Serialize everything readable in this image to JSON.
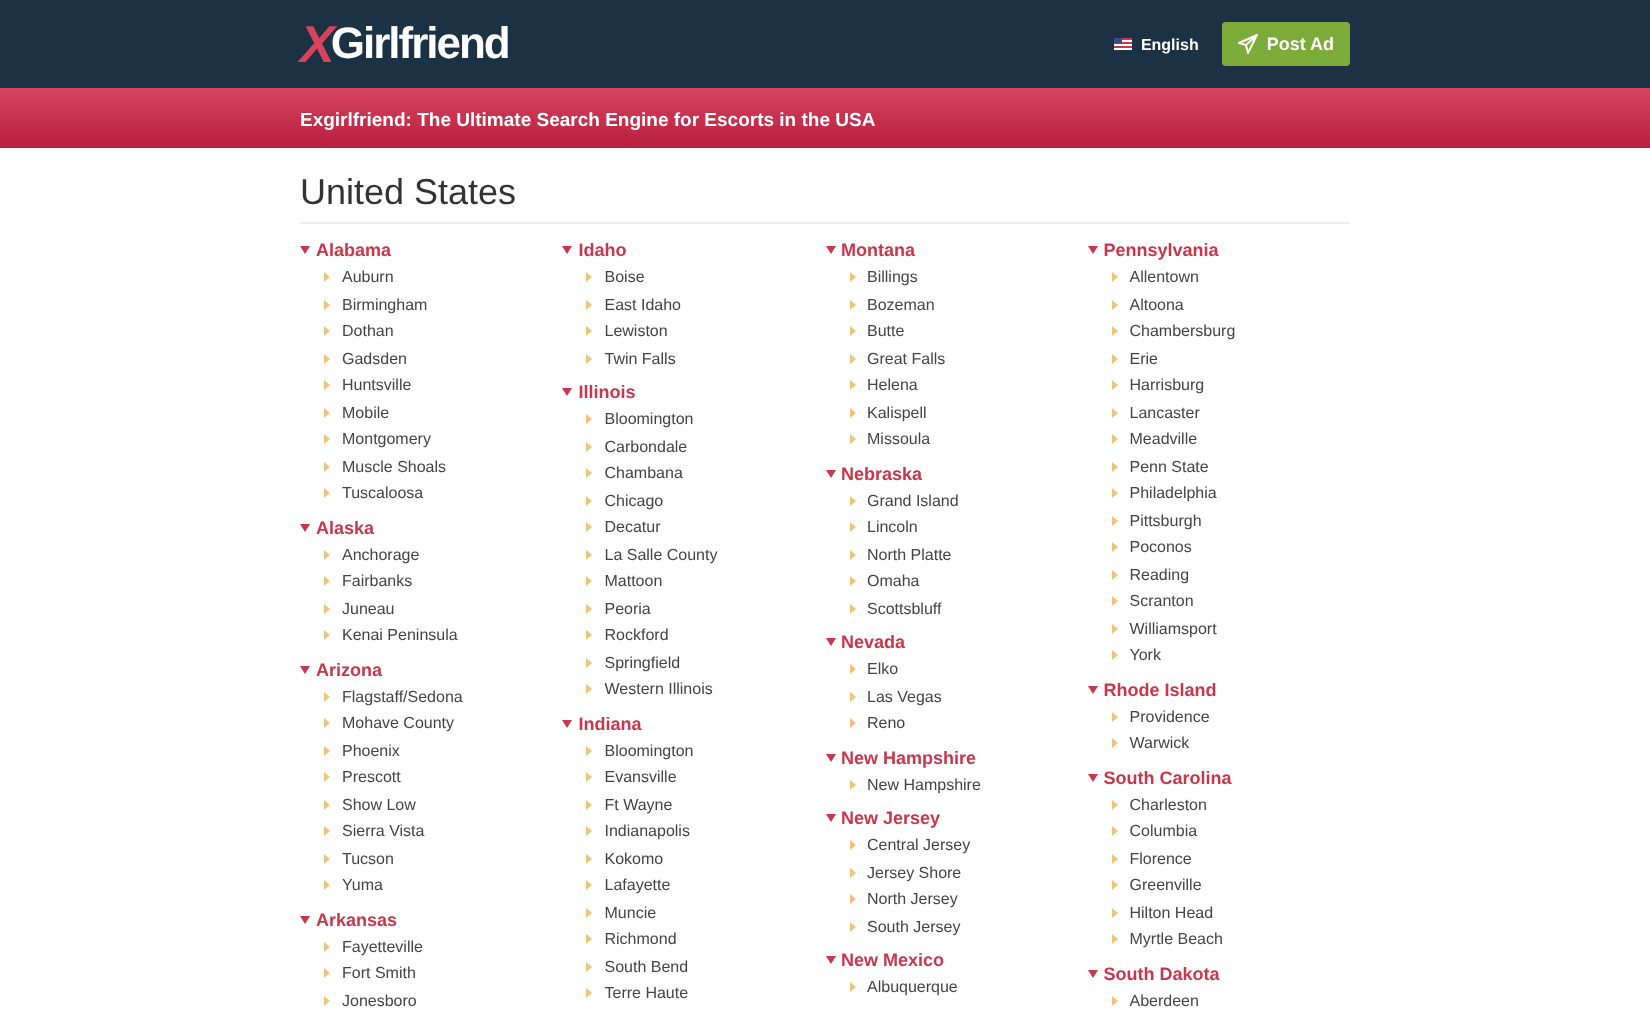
{
  "header": {
    "logo_mark": "X",
    "logo_text": "Girlfriend",
    "language": "English",
    "post_button": "Post Ad"
  },
  "banner": {
    "text": "Exgirlfriend: The Ultimate Search Engine for Escorts in the USA"
  },
  "page_title": "United States",
  "columns": [
    {
      "states": [
        {
          "name": "Alabama",
          "cities": [
            "Auburn",
            "Birmingham",
            "Dothan",
            "Gadsden",
            "Huntsville",
            "Mobile",
            "Montgomery",
            "Muscle Shoals",
            "Tuscaloosa"
          ]
        },
        {
          "name": "Alaska",
          "cities": [
            "Anchorage",
            "Fairbanks",
            "Juneau",
            "Kenai Peninsula"
          ]
        },
        {
          "name": "Arizona",
          "cities": [
            "Flagstaff/Sedona",
            "Mohave County",
            "Phoenix",
            "Prescott",
            "Show Low",
            "Sierra Vista",
            "Tucson",
            "Yuma"
          ]
        },
        {
          "name": "Arkansas",
          "cities": [
            "Fayetteville",
            "Fort Smith",
            "Jonesboro"
          ]
        }
      ]
    },
    {
      "states": [
        {
          "name": "Idaho",
          "cities": [
            "Boise",
            "East Idaho",
            "Lewiston",
            "Twin Falls"
          ]
        },
        {
          "name": "Illinois",
          "cities": [
            "Bloomington",
            "Carbondale",
            "Chambana",
            "Chicago",
            "Decatur",
            "La Salle County",
            "Mattoon",
            "Peoria",
            "Rockford",
            "Springfield",
            "Western Illinois"
          ]
        },
        {
          "name": "Indiana",
          "cities": [
            "Bloomington",
            "Evansville",
            "Ft Wayne",
            "Indianapolis",
            "Kokomo",
            "Lafayette",
            "Muncie",
            "Richmond",
            "South Bend",
            "Terre Haute"
          ]
        }
      ]
    },
    {
      "states": [
        {
          "name": "Montana",
          "cities": [
            "Billings",
            "Bozeman",
            "Butte",
            "Great Falls",
            "Helena",
            "Kalispell",
            "Missoula"
          ]
        },
        {
          "name": "Nebraska",
          "cities": [
            "Grand Island",
            "Lincoln",
            "North Platte",
            "Omaha",
            "Scottsbluff"
          ]
        },
        {
          "name": "Nevada",
          "cities": [
            "Elko",
            "Las Vegas",
            "Reno"
          ]
        },
        {
          "name": "New Hampshire",
          "cities": [
            "New Hampshire"
          ]
        },
        {
          "name": "New Jersey",
          "cities": [
            "Central Jersey",
            "Jersey Shore",
            "North Jersey",
            "South Jersey"
          ]
        },
        {
          "name": "New Mexico",
          "cities": [
            "Albuquerque"
          ]
        }
      ]
    },
    {
      "states": [
        {
          "name": "Pennsylvania",
          "cities": [
            "Allentown",
            "Altoona",
            "Chambersburg",
            "Erie",
            "Harrisburg",
            "Lancaster",
            "Meadville",
            "Penn State",
            "Philadelphia",
            "Pittsburgh",
            "Poconos",
            "Reading",
            "Scranton",
            "Williamsport",
            "York"
          ]
        },
        {
          "name": "Rhode Island",
          "cities": [
            "Providence",
            "Warwick"
          ]
        },
        {
          "name": "South Carolina",
          "cities": [
            "Charleston",
            "Columbia",
            "Florence",
            "Greenville",
            "Hilton Head",
            "Myrtle Beach"
          ]
        },
        {
          "name": "South Dakota",
          "cities": [
            "Aberdeen"
          ]
        }
      ]
    }
  ]
}
